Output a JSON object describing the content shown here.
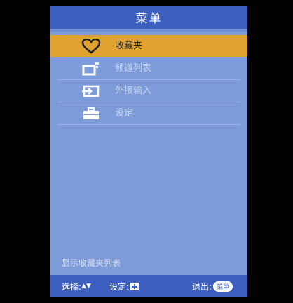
{
  "menu": {
    "title": "菜单",
    "items": [
      {
        "label": "收藏夹",
        "icon": "heart-icon",
        "selected": true
      },
      {
        "label": "频道列表",
        "icon": "channel-list-icon",
        "selected": false
      },
      {
        "label": "外接输入",
        "icon": "external-input-icon",
        "selected": false
      },
      {
        "label": "设定",
        "icon": "toolbox-icon",
        "selected": false
      }
    ],
    "description": "显示收藏夹列表"
  },
  "footer": {
    "select_label": "选择:",
    "select_keys": "▲▼",
    "set_label": "设定:",
    "exit_label": "退出:",
    "exit_key": "菜单"
  },
  "colors": {
    "panel": "#7d9bd9",
    "header": "#3d5fc0",
    "highlight": "#e1a330"
  }
}
